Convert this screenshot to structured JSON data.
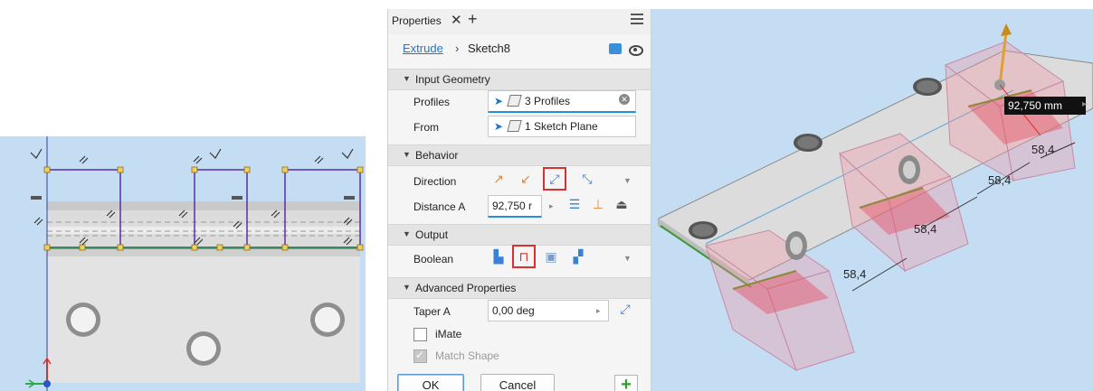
{
  "properties": {
    "tab_title": "Properties",
    "breadcrumb": {
      "feature": "Extrude",
      "separator": "›",
      "sketch": "Sketch8"
    },
    "sections": {
      "input_geometry": "Input Geometry",
      "behavior": "Behavior",
      "output": "Output",
      "advanced": "Advanced Properties"
    },
    "profiles": {
      "label": "Profiles",
      "value": "3 Profiles"
    },
    "from": {
      "label": "From",
      "value": "1 Sketch Plane"
    },
    "direction": {
      "label": "Direction"
    },
    "distance_a": {
      "label": "Distance A",
      "value": "92,750 r"
    },
    "boolean": {
      "label": "Boolean"
    },
    "taper_a": {
      "label": "Taper A",
      "value": "0,00 deg"
    },
    "imate": {
      "label": "iMate",
      "checked": false
    },
    "match_shape": {
      "label": "Match Shape",
      "checked": true,
      "enabled": false
    },
    "buttons": {
      "ok": "OK",
      "cancel": "Cancel"
    }
  },
  "viewport3d": {
    "distance_readout": "92,750 mm",
    "dims": [
      "58,4",
      "58,4",
      "58,4",
      "58,4"
    ]
  },
  "colors": {
    "accent": "#1b78c9",
    "highlight": "#d93030",
    "viewport_bg": "#c5ddf2"
  }
}
